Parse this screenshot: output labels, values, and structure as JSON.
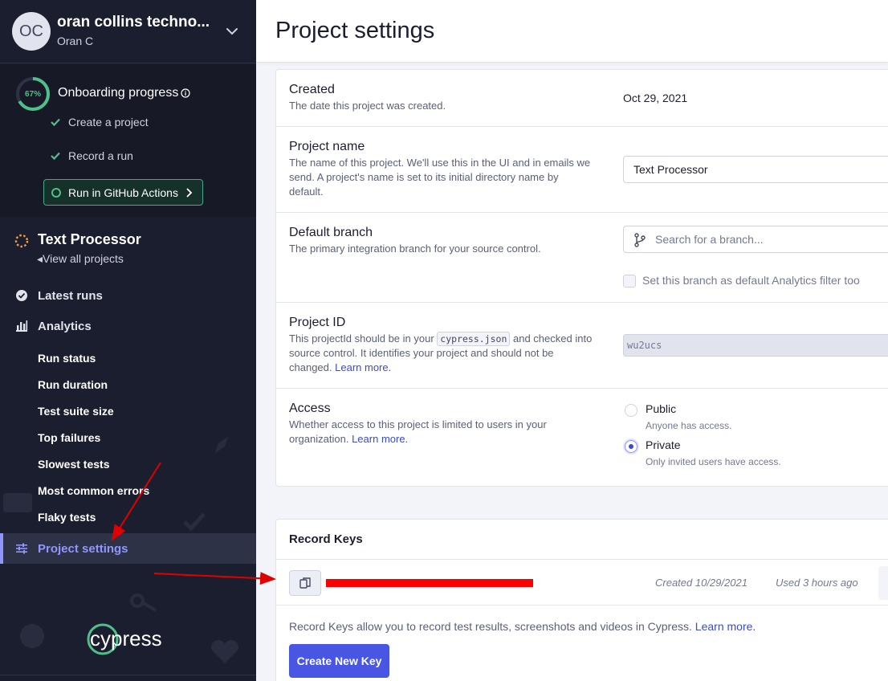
{
  "org": {
    "initials": "OC",
    "name": "oran collins techno...",
    "user": "Oran C"
  },
  "onboarding": {
    "progress_pct": "67%",
    "progress_value": 0.67,
    "title": "Onboarding progress",
    "steps": [
      {
        "label": "Create a project",
        "done": true
      },
      {
        "label": "Record a run",
        "done": true
      }
    ],
    "github_button": "Run in GitHub Actions"
  },
  "project": {
    "name": "Text Processor",
    "view_all": "View all projects"
  },
  "nav": {
    "latest_runs": "Latest runs",
    "analytics": "Analytics",
    "analytics_items": [
      "Run status",
      "Run duration",
      "Test suite size",
      "Top failures",
      "Slowest tests",
      "Most common errors",
      "Flaky tests"
    ],
    "project_settings": "Project settings"
  },
  "page": {
    "title": "Project settings"
  },
  "settings": {
    "created": {
      "title": "Created",
      "desc": "The date this project was created.",
      "value": "Oct 29, 2021"
    },
    "project_name": {
      "title": "Project name",
      "desc": "The name of this project. We'll use this in the UI and in emails we send. A project's name is set to its initial directory name by default.",
      "value": "Text Processor"
    },
    "default_branch": {
      "title": "Default branch",
      "desc": "The primary integration branch for your source control.",
      "placeholder": "Search for a branch...",
      "checkbox_label": "Set this branch as default Analytics filter too"
    },
    "project_id": {
      "title": "Project ID",
      "desc_pre": "This projectId should be in your",
      "desc_code": "cypress.json",
      "desc_mid": "and checked into source control. It identifies your project and should not be changed.",
      "learn_more": "Learn more.",
      "value": "wu2ucs"
    },
    "access": {
      "title": "Access",
      "desc": "Whether access to this project is limited to users in your organization.",
      "learn_more": "Learn more.",
      "options": [
        {
          "label": "Public",
          "desc": "Anyone has access.",
          "selected": false
        },
        {
          "label": "Private",
          "desc": "Only invited users have access.",
          "selected": true
        }
      ]
    }
  },
  "record_keys": {
    "title": "Record Keys",
    "created": "Created 10/29/2021",
    "used": "Used 3 hours ago",
    "desc": "Record Keys allow you to record test results, screenshots and videos in Cypress.",
    "learn_more": "Learn more.",
    "create_button": "Create New Key"
  },
  "colors": {
    "accent": "#4956e3",
    "sidebar_bg": "#1b1e2e",
    "success": "#4ec18b",
    "active_nav": "#9095ff",
    "annotation": "#e00000"
  }
}
